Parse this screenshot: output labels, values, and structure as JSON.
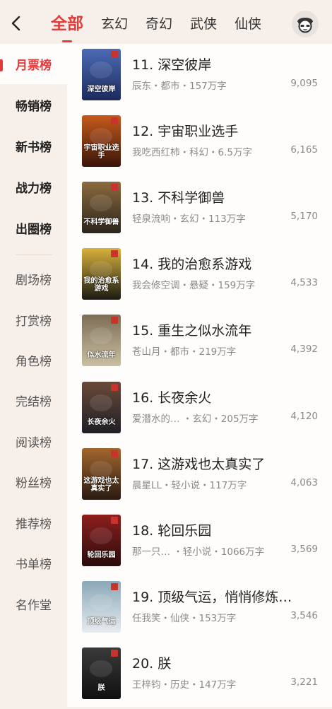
{
  "header": {
    "tabs": [
      {
        "label": "全部",
        "active": true
      },
      {
        "label": "玄幻"
      },
      {
        "label": "奇幻"
      },
      {
        "label": "武侠"
      },
      {
        "label": "仙侠"
      }
    ],
    "accent_color": "#e23b3b"
  },
  "sidebar": {
    "items": [
      {
        "label": "月票榜",
        "active": true
      },
      {
        "label": "畅销榜",
        "strong": true
      },
      {
        "label": "新书榜",
        "strong": true
      },
      {
        "label": "战力榜",
        "strong": true
      },
      {
        "label": "出圈榜",
        "strong": true
      },
      {
        "label": "剧场榜"
      },
      {
        "label": "打赏榜"
      },
      {
        "label": "角色榜"
      },
      {
        "label": "完结榜"
      },
      {
        "label": "阅读榜"
      },
      {
        "label": "粉丝榜"
      },
      {
        "label": "推荐榜"
      },
      {
        "label": "书单榜"
      },
      {
        "label": "名作堂"
      }
    ]
  },
  "books": [
    {
      "title": "11. 深空彼岸",
      "meta": "辰东・都市・157万字",
      "count": "9,095",
      "cover_text": "深空彼岸",
      "cover_colors": [
        "#1d2a5c",
        "#4b6bb5"
      ]
    },
    {
      "title": "12. 宇宙职业选手",
      "meta": "我吃西红柿・科幻・6.5万字",
      "count": "6,165",
      "cover_text": "宇宙职业选手",
      "cover_colors": [
        "#3a1408",
        "#c65a1c"
      ]
    },
    {
      "title": "13. 不科学御兽",
      "meta": "轻泉流响・玄幻・113万字",
      "count": "5,170",
      "cover_text": "不科学御兽",
      "cover_colors": [
        "#2b241c",
        "#8c6a3e"
      ]
    },
    {
      "title": "14. 我的治愈系游戏",
      "meta": "我会修空调・悬疑・159万字",
      "count": "4,533",
      "cover_text": "我的治愈系游戏",
      "cover_colors": [
        "#1b1a14",
        "#d9b23a"
      ]
    },
    {
      "title": "15. 重生之似水流年",
      "meta": "苍山月・都市・219万字",
      "count": "4,392",
      "cover_text": "似水流年",
      "cover_colors": [
        "#c9bfa2",
        "#7d6d55"
      ]
    },
    {
      "title": "16. 长夜余火",
      "meta": "爱潜水的…  ・玄幻・205万字",
      "count": "4,120",
      "cover_text": "长夜余火",
      "cover_colors": [
        "#1e1e24",
        "#6a4a3a"
      ]
    },
    {
      "title": "17. 这游戏也太真实了",
      "meta": "晨星LL・轻小说・117万字",
      "count": "4,063",
      "cover_text": "这游戏也太真实了",
      "cover_colors": [
        "#2a1a12",
        "#a3672c"
      ]
    },
    {
      "title": "18. 轮回乐园",
      "meta": "那一只…  ・轻小说・1066万字",
      "count": "3,569",
      "cover_text": "轮回乐园",
      "cover_colors": [
        "#2a0c0c",
        "#8e1e1e"
      ]
    },
    {
      "title": "19. 顶级气运，悄悄修炼…",
      "meta": "任我笑・仙侠・153万字",
      "count": "3,546",
      "cover_text": "顶级气运",
      "cover_colors": [
        "#e8ecef",
        "#8aa7b8"
      ]
    },
    {
      "title": "20. 朕",
      "meta": "王梓钧・历史・147万字",
      "count": "3,221",
      "cover_text": "朕",
      "cover_colors": [
        "#101010",
        "#3a3a3a"
      ]
    }
  ]
}
